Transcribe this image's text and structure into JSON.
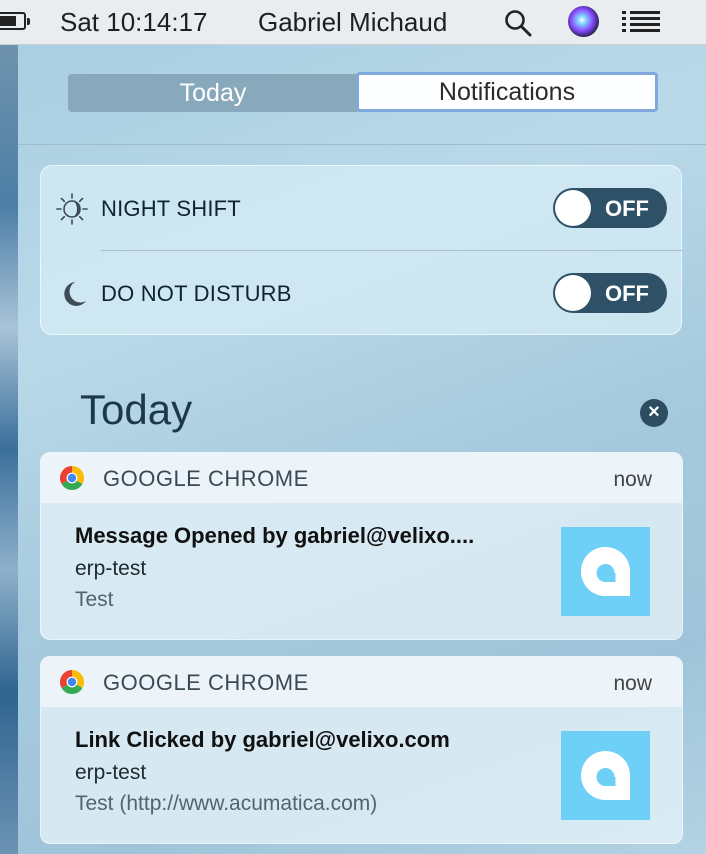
{
  "menubar": {
    "clock": "Sat 10:14:17",
    "user": "Gabriel Michaud",
    "icons": [
      "battery-icon",
      "search-icon",
      "siri-icon",
      "list-icon"
    ]
  },
  "tabs": [
    {
      "label": "Today",
      "selected": false
    },
    {
      "label": "Notifications",
      "selected": true
    }
  ],
  "toggles": [
    {
      "label": "NIGHT SHIFT",
      "state": "OFF",
      "icon": "night-shift-icon"
    },
    {
      "label": "DO NOT DISTURB",
      "state": "OFF",
      "icon": "moon-icon"
    }
  ],
  "section": {
    "title": "Today",
    "clear_icon": "close-icon"
  },
  "notifications": [
    {
      "app": "GOOGLE CHROME",
      "time": "now",
      "title": "Message Opened by gabriel@velixo....",
      "subtitle": "erp-test",
      "body": "Test"
    },
    {
      "app": "GOOGLE CHROME",
      "time": "now",
      "title": "Link Clicked by gabriel@velixo.com",
      "subtitle": "erp-test",
      "body": "Test (http://www.acumatica.com)"
    }
  ],
  "colors": {
    "switch_bg": "#2f5167",
    "tile_bg": "#6fd0f7",
    "selected_tab_border": "#7fa8dc"
  }
}
